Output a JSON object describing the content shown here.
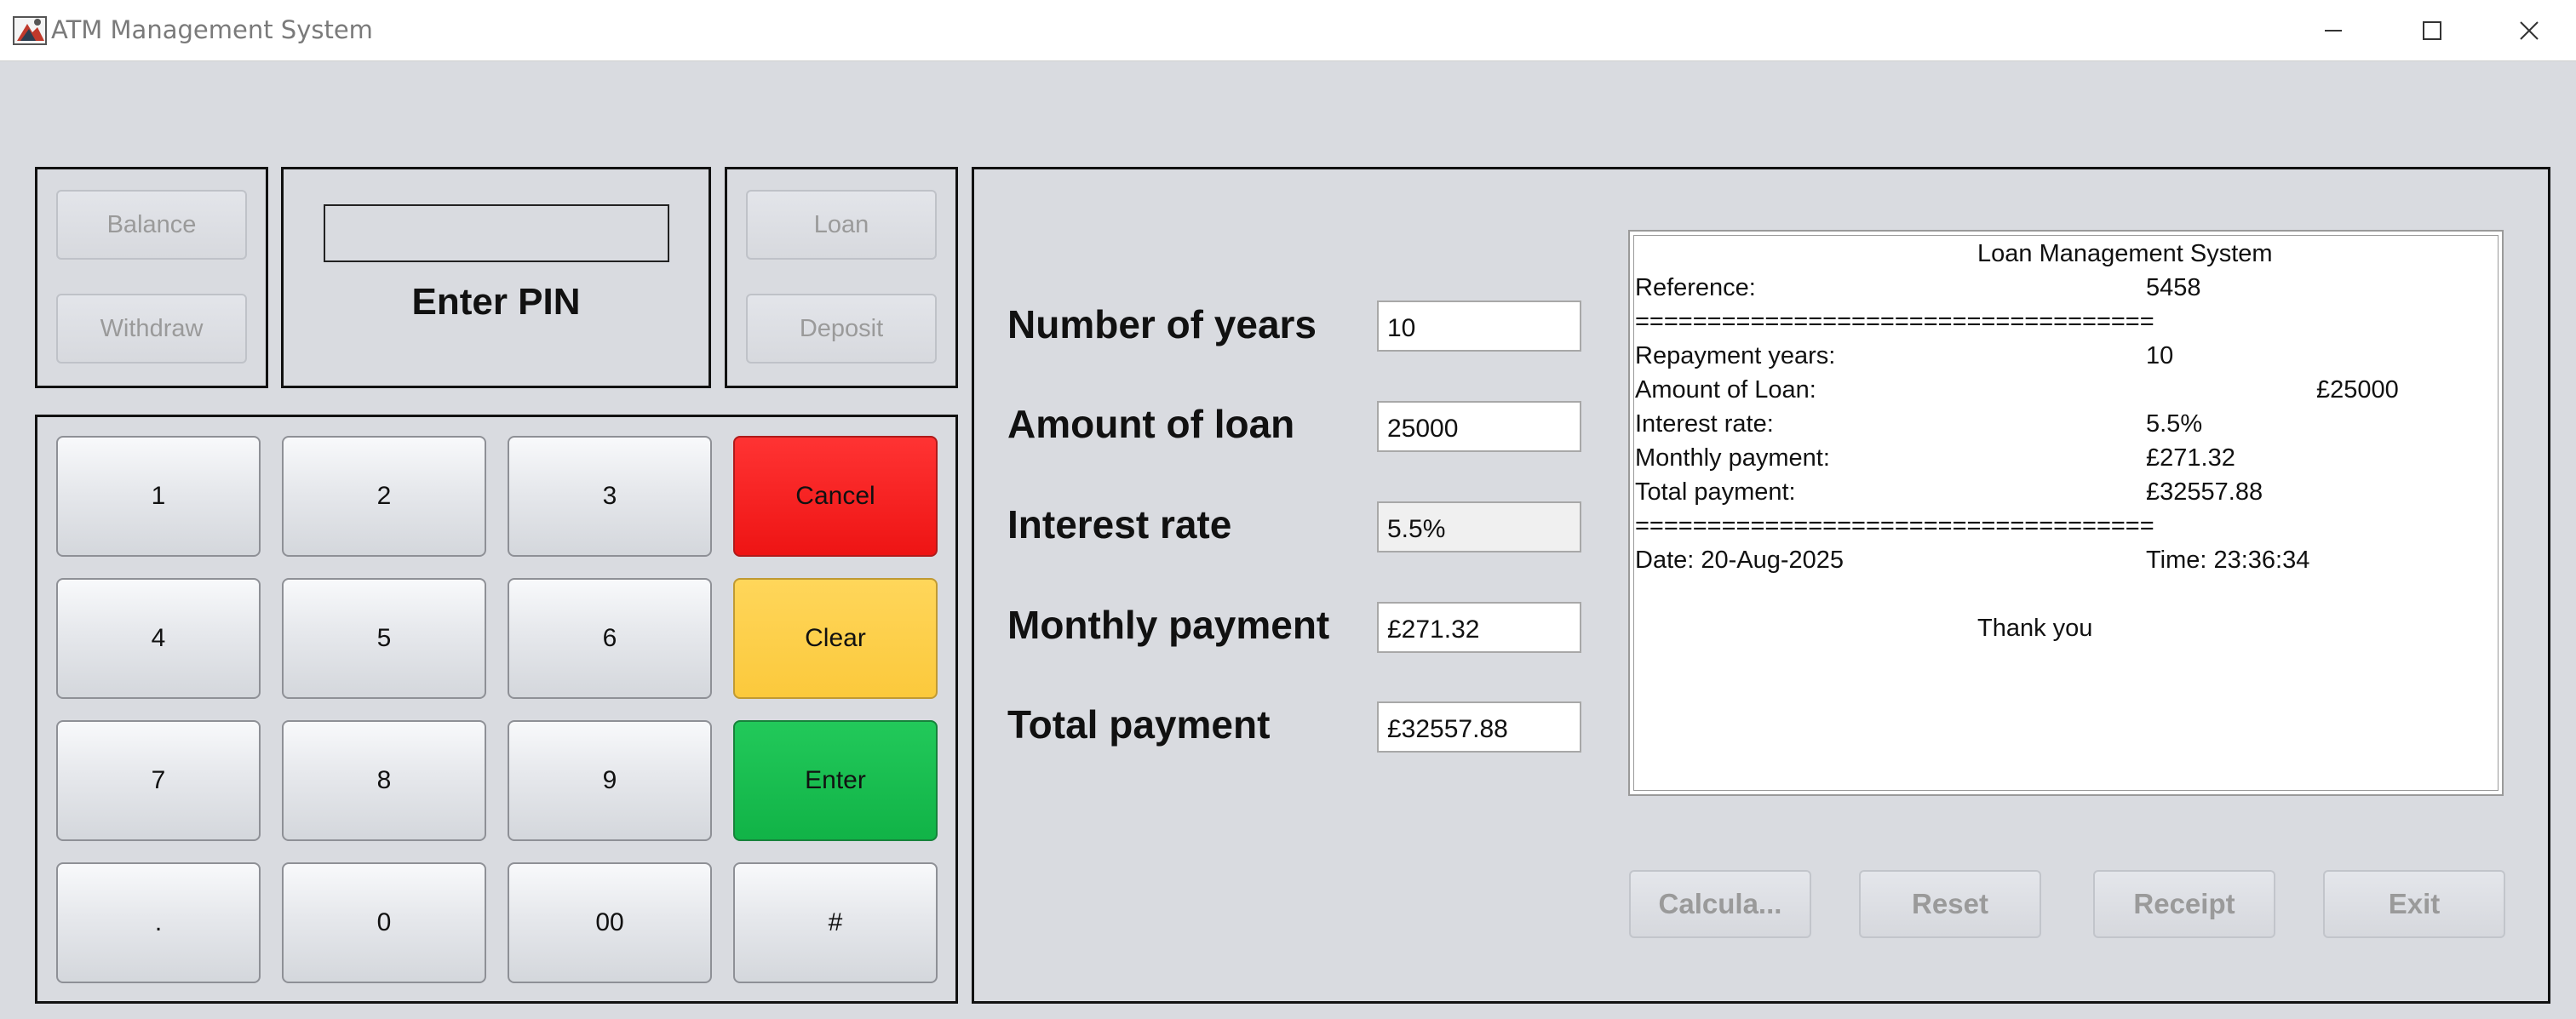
{
  "window": {
    "title": "ATM Management System"
  },
  "atm": {
    "balance_label": "Balance",
    "withdraw_label": "Withdraw",
    "loan_label": "Loan",
    "deposit_label": "Deposit",
    "pin_value": "",
    "pin_label": "Enter PIN"
  },
  "keypad": {
    "keys": [
      "1",
      "2",
      "3",
      "Cancel",
      "4",
      "5",
      "6",
      "Clear",
      "7",
      "8",
      "9",
      "Enter",
      ".",
      "0",
      "00",
      "#"
    ],
    "colors": {
      "cancel": "#ee1414",
      "clear": "#fbc93c",
      "enter": "#11b347"
    }
  },
  "loan": {
    "years_label": "Number of years",
    "years_value": "10",
    "amount_label": "Amount of loan",
    "amount_value": "25000",
    "rate_label": "Interest rate",
    "rate_value": "5.5%",
    "monthly_label": "Monthly payment",
    "monthly_value": "£271.32",
    "total_label": "Total payment",
    "total_value": "£32557.88"
  },
  "receipt": {
    "title": "Loan Management System",
    "reference_label": "Reference:",
    "reference_value": "5458",
    "separator": "====================================",
    "years_label": "Repayment years:",
    "years_value": "10",
    "amount_label": "Amount of Loan:",
    "amount_value": "£25000",
    "rate_label": "Interest rate:",
    "rate_value": "5.5%",
    "monthly_label": "Monthly payment:",
    "monthly_value": "£271.32",
    "total_label": "Total payment:",
    "total_value": "£32557.88",
    "date": "Date: 20-Aug-2025",
    "time": "Time: 23:36:34",
    "thanks": "Thank you"
  },
  "actions": {
    "calculate_label": "Calcula...",
    "reset_label": "Reset",
    "receipt_label": "Receipt",
    "exit_label": "Exit"
  }
}
